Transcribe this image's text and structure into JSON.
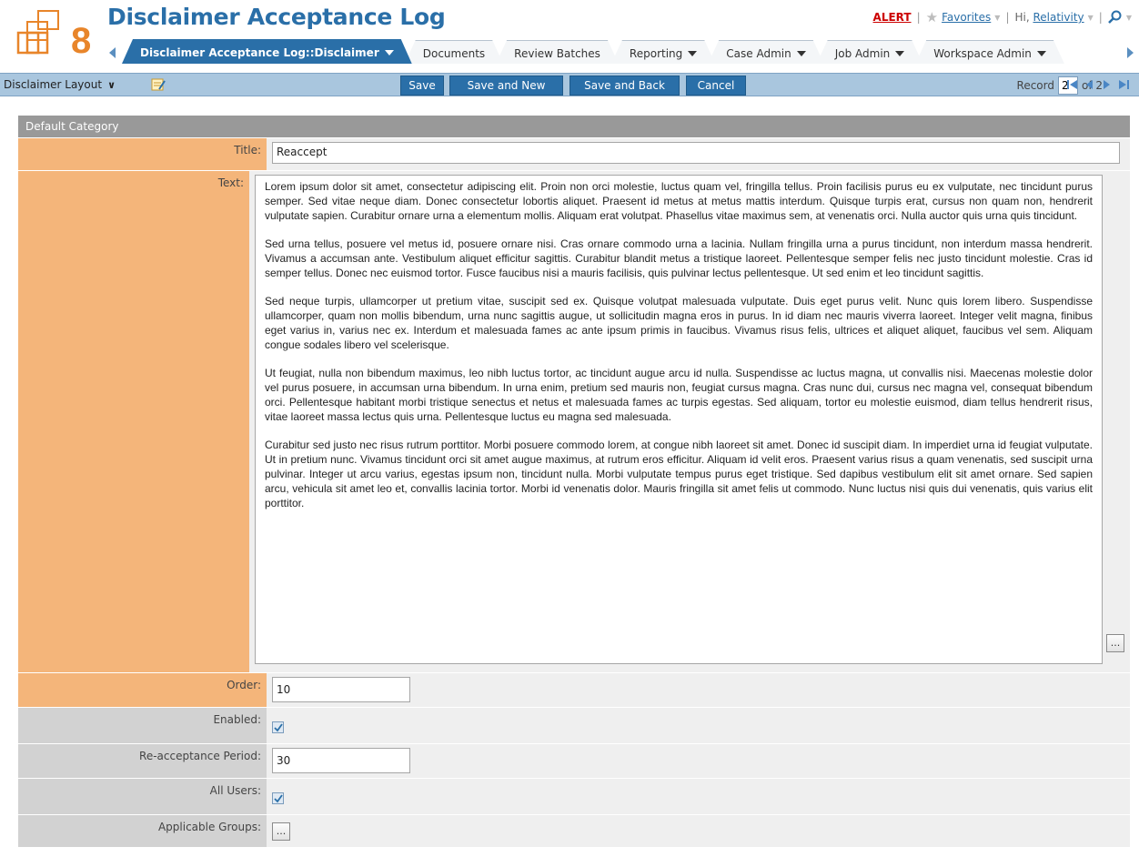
{
  "app": {
    "title": "Disclaimer Acceptance Log"
  },
  "header": {
    "alert_label": "ALERT",
    "favorites_label": "Favorites",
    "greeting_prefix": "Hi,",
    "user_label": "Relativity",
    "icons": [
      "logo-icon",
      "star-icon",
      "search-icon"
    ]
  },
  "tabs": [
    {
      "label": "Disclaimer Acceptance Log::Disclaimer",
      "active": true,
      "dropdown": true
    },
    {
      "label": "Documents",
      "active": false,
      "dropdown": false
    },
    {
      "label": "Review Batches",
      "active": false,
      "dropdown": false
    },
    {
      "label": "Reporting",
      "active": false,
      "dropdown": true
    },
    {
      "label": "Case Admin",
      "active": false,
      "dropdown": true
    },
    {
      "label": "Job Admin",
      "active": false,
      "dropdown": true
    },
    {
      "label": "Workspace Admin",
      "active": false,
      "dropdown": true
    }
  ],
  "toolbar": {
    "layout_label": "Disclaimer Layout",
    "save_label": "Save",
    "save_new_label": "Save and New",
    "save_back_label": "Save and Back",
    "cancel_label": "Cancel",
    "record_label": "Record",
    "record_value": "2",
    "record_total": "of 2"
  },
  "form": {
    "category": "Default Category",
    "title_label": "Title:",
    "title_value": "Reaccept",
    "text_label": "Text:",
    "text_paragraphs": [
      "Lorem ipsum dolor sit amet, consectetur adipiscing elit. Proin non orci molestie, luctus quam vel, fringilla tellus. Proin facilisis purus eu ex vulputate, nec tincidunt purus semper. Sed vitae neque diam. Donec consectetur lobortis aliquet. Praesent id metus at metus mattis interdum. Quisque turpis erat, cursus non quam non, hendrerit vulputate sapien. Curabitur ornare urna a elementum mollis. Aliquam erat volutpat. Phasellus vitae maximus sem, at venenatis orci. Nulla auctor quis urna quis tincidunt.",
      "Sed urna tellus, posuere vel metus id, posuere ornare nisi. Cras ornare commodo urna a lacinia. Nullam fringilla urna a purus tincidunt, non interdum massa hendrerit. Vivamus a accumsan ante. Vestibulum aliquet efficitur sagittis. Curabitur blandit metus a tristique laoreet. Pellentesque semper felis nec justo tincidunt molestie. Cras id semper tellus. Donec nec euismod tortor. Fusce faucibus nisi a mauris facilisis, quis pulvinar lectus pellentesque. Ut sed enim et leo tincidunt sagittis.",
      "Sed neque turpis, ullamcorper ut pretium vitae, suscipit sed ex. Quisque volutpat malesuada vulputate. Duis eget purus velit. Nunc quis lorem libero. Suspendisse ullamcorper, quam non mollis bibendum, urna nunc sagittis augue, ut sollicitudin magna eros in purus. In id diam nec mauris viverra laoreet. Integer velit magna, finibus eget varius in, varius nec ex. Interdum et malesuada fames ac ante ipsum primis in faucibus. Vivamus risus felis, ultrices et aliquet aliquet, faucibus vel sem. Aliquam congue sodales libero vel scelerisque.",
      "Ut feugiat, nulla non bibendum maximus, leo nibh luctus tortor, ac tincidunt augue arcu id nulla. Suspendisse ac luctus magna, ut convallis nisi. Maecenas molestie dolor vel purus posuere, in accumsan urna bibendum. In urna enim, pretium sed mauris non, feugiat cursus magna. Cras nunc dui, cursus nec magna vel, consequat bibendum orci. Pellentesque habitant morbi tristique senectus et netus et malesuada fames ac turpis egestas. Sed aliquam, tortor eu molestie euismod, diam tellus hendrerit risus, vitae laoreet massa lectus quis urna. Pellentesque luctus eu magna sed malesuada.",
      "Curabitur sed justo nec risus rutrum porttitor. Morbi posuere commodo lorem, at congue nibh laoreet sit amet. Donec id suscipit diam. In imperdiet urna id feugiat vulputate. Ut in pretium nunc. Vivamus tincidunt orci sit amet augue maximus, at rutrum eros efficitur. Aliquam id velit eros. Praesent varius risus a quam venenatis, sed suscipit urna pulvinar. Integer ut arcu varius, egestas ipsum non, tincidunt nulla. Morbi vulputate tempus purus eget tristique. Sed dapibus vestibulum elit sit amet ornare. Sed sapien arcu, vehicula sit amet leo et, convallis lacinia tortor. Morbi id venenatis dolor. Mauris fringilla sit amet felis ut commodo. Nunc luctus nisi quis dui venenatis, quis varius elit porttitor."
    ],
    "ellipsis_label": "...",
    "order_label": "Order:",
    "order_value": "10",
    "enabled_label": "Enabled:",
    "enabled_checked": true,
    "period_label": "Re-acceptance Period:",
    "period_value": "30",
    "all_users_label": "All Users:",
    "all_users_checked": true,
    "groups_label": "Applicable Groups:"
  },
  "colors": {
    "brand_blue": "#2a6fa8",
    "toolbar_blue": "#a9c6de",
    "required_label": "#f4b57a",
    "optional_label": "#d2d2d2",
    "category_header": "#999999",
    "logo_orange": "#e8852a"
  }
}
